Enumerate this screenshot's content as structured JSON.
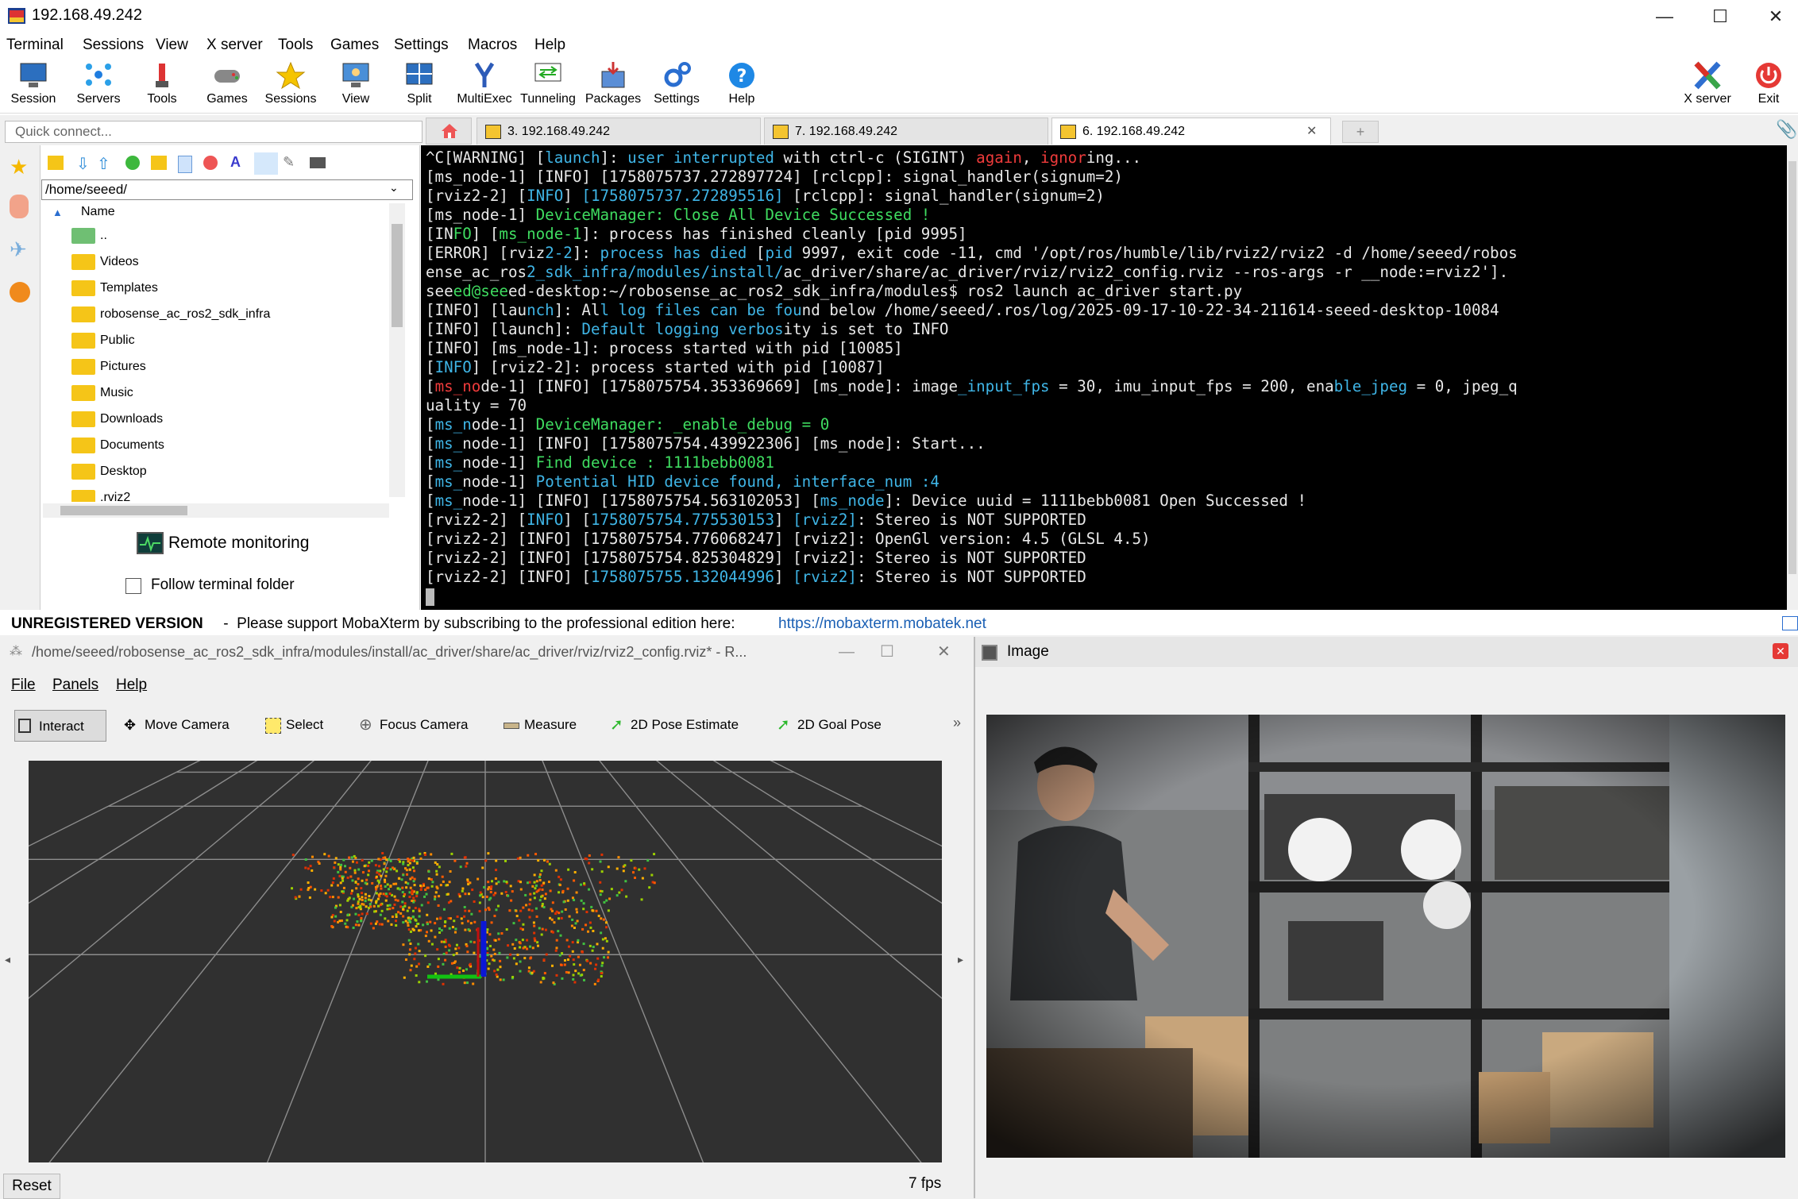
{
  "window": {
    "title": "192.168.49.242"
  },
  "menu": [
    "Terminal",
    "Sessions",
    "View",
    "X server",
    "Tools",
    "Games",
    "Settings",
    "Macros",
    "Help"
  ],
  "toolbar": {
    "left": [
      "Session",
      "Servers",
      "Tools",
      "Games",
      "Sessions",
      "View",
      "Split",
      "MultiExec",
      "Tunneling",
      "Packages",
      "Settings",
      "Help"
    ],
    "xserver": "X server",
    "exit": "Exit"
  },
  "quick_connect": {
    "placeholder": "Quick connect..."
  },
  "tabs": [
    {
      "label": "3. 192.168.49.242"
    },
    {
      "label": "7. 192.168.49.242"
    },
    {
      "label": "6. 192.168.49.242"
    }
  ],
  "sftp": {
    "path": "/home/seeed/",
    "column_name": "Name",
    "files": [
      "..",
      "Videos",
      "Templates",
      "robosense_ac_ros2_sdk_infra",
      "Public",
      "Pictures",
      "Music",
      "Downloads",
      "Documents",
      "Desktop",
      ".rviz2"
    ],
    "remote_monitoring": "Remote monitoring",
    "follow_folder": "Follow terminal folder"
  },
  "terminal": {
    "lines": [
      "^C[WARNING] [launch]: user interrupted with ctrl-c (SIGINT) again, ignoring...",
      "[ms_node-1] [INFO] [1758075737.272897724] [rclcpp]: signal_handler(signum=2)",
      "[rviz2-2] [INFO] [1758075737.272895516] [rclcpp]: signal_handler(signum=2)",
      "[ms_node-1] DeviceManager: Close All Device Successed !",
      "[INFO] [ms_node-1]: process has finished cleanly [pid 9995]",
      "[ERROR] [rviz2-2]: process has died [pid 9997, exit code -11, cmd '/opt/ros/humble/lib/rviz2/rviz2 -d /home/seeed/robos",
      "ense_ac_ros2_sdk_infra/modules/install/ac_driver/share/ac_driver/rviz/rviz2_config.rviz --ros-args -r __node:=rviz2'].",
      "seeed@seeed-desktop:~/robosense_ac_ros2_sdk_infra/modules$ ros2 launch ac_driver start.py",
      "[INFO] [launch]: All log files can be found below /home/seeed/.ros/log/2025-09-17-10-22-34-211614-seeed-desktop-10084",
      "[INFO] [launch]: Default logging verbosity is set to INFO",
      "[INFO] [ms_node-1]: process started with pid [10085]",
      "[INFO] [rviz2-2]: process started with pid [10087]",
      "[ms_node-1] [INFO] [1758075754.353369669] [ms_node]: image_input_fps = 30, imu_input_fps = 200, enable_jpeg = 0, jpeg_q",
      "uality = 70",
      "[ms_node-1] DeviceManager: _enable_debug = 0",
      "[ms_node-1] [INFO] [1758075754.439922306] [ms_node]: Start...",
      "[ms_node-1] Find device : 1111bebb0081",
      "[ms_node-1] Potential HID device found, interface_num :4",
      "[ms_node-1] [INFO] [1758075754.563102053] [ms_node]: Device uuid = 1111bebb0081 Open Successed !",
      "[rviz2-2] [INFO] [1758075754.775530153] [rviz2]: Stereo is NOT SUPPORTED",
      "[rviz2-2] [INFO] [1758075754.776068247] [rviz2]: OpenGl version: 4.5 (GLSL 4.5)",
      "[rviz2-2] [INFO] [1758075754.825304829] [rviz2]: Stereo is NOT SUPPORTED",
      "[rviz2-2] [INFO] [1758075755.132044996] [rviz2]: Stereo is NOT SUPPORTED"
    ]
  },
  "status": {
    "unregistered": "UNREGISTERED VERSION",
    "message": " -  Please support MobaXterm by subscribing to the professional edition here:",
    "link": "https://mobaxterm.mobatek.net"
  },
  "rviz": {
    "title": "/home/seeed/robosense_ac_ros2_sdk_infra/modules/install/ac_driver/share/ac_driver/rviz/rviz2_config.rviz* - R...",
    "menu": [
      "File",
      "Panels",
      "Help"
    ],
    "tools": [
      "Interact",
      "Move Camera",
      "Select",
      "Focus Camera",
      "Measure",
      "2D Pose Estimate",
      "2D Goal Pose"
    ],
    "reset": "Reset",
    "fps": "7 fps"
  },
  "image_window": {
    "title": "Image"
  },
  "colors": {
    "terminal_bg": "#000000",
    "cyan": "#3fb5e6",
    "green": "#3fdc60",
    "red": "#ef3b3b",
    "render_bg": "#303030"
  }
}
